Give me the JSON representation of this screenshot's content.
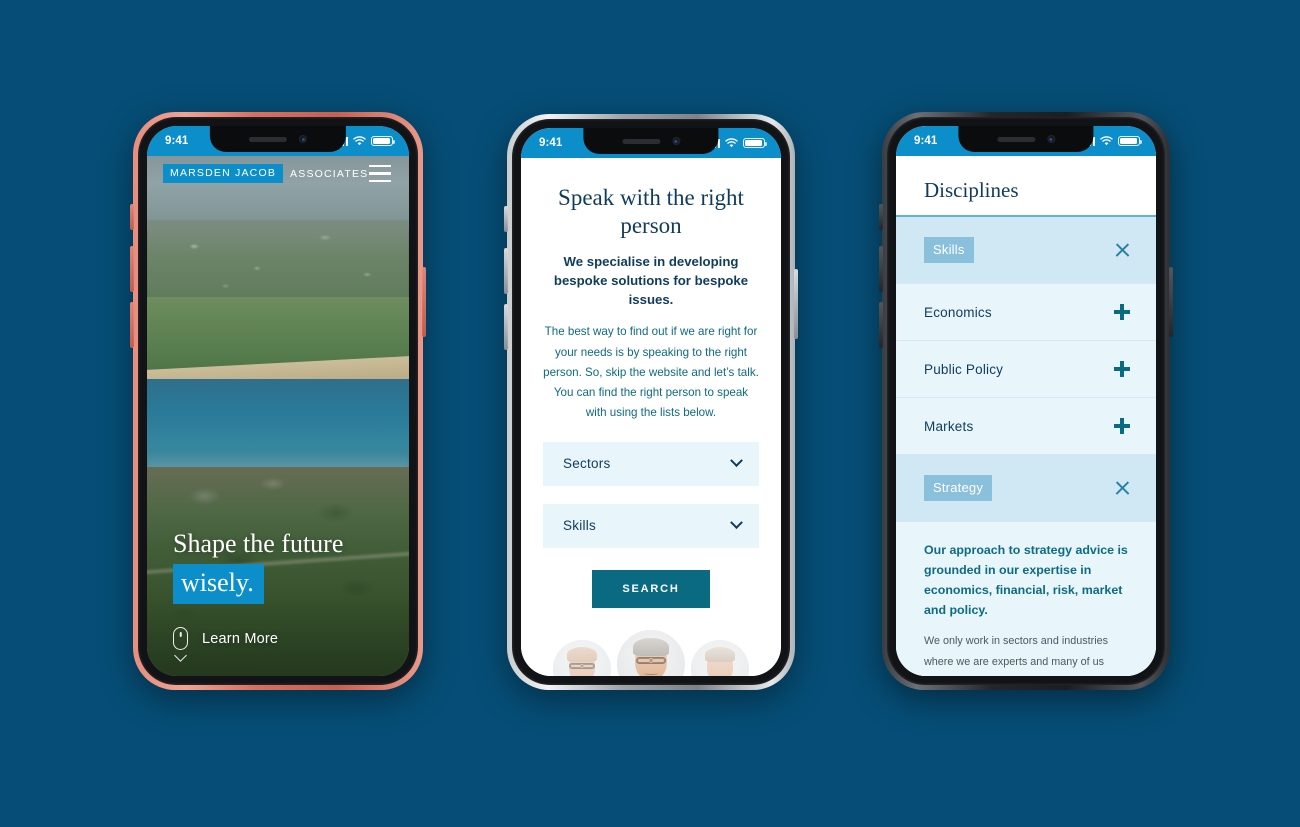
{
  "canvas": {
    "background_color": "#064e77"
  },
  "brand": {
    "accent_blue": "#0c8ecb",
    "deep_teal": "#0a6a82",
    "navy": "#0f3c5c",
    "pale_blue": "#e8f5fb",
    "chip_blue": "#8bc0dd"
  },
  "status_bar": {
    "time": "9:41",
    "signal": "signal-bars",
    "wifi": "wifi-icon",
    "battery": "battery-icon"
  },
  "phone1": {
    "frame_color": "coral",
    "nav": {
      "logo_mark": "MARSDEN JACOB",
      "logo_sub": "ASSOCIATES",
      "menu": "hamburger-menu"
    },
    "hero": {
      "headline_line1": "Shape the future",
      "headline_line2": "wisely.",
      "cta_label": "Learn More",
      "cta_icon": "scroll-mouse-icon"
    }
  },
  "phone2": {
    "frame_color": "silver",
    "title": "Speak with the right person",
    "lead": "We specialise in developing bespoke solutions for bespoke issues.",
    "paragraph": "The best way to find out if we are right for your needs is by speaking to the right person. So, skip the website and let’s talk. You can find the right person to speak with using the lists below.",
    "selects": [
      {
        "label": "Sectors",
        "icon": "chevron-down-icon"
      },
      {
        "label": "Skills",
        "icon": "chevron-down-icon"
      }
    ],
    "search_button": "SEARCH",
    "avatars": [
      {
        "name": "consultant-avatar-1",
        "size": "small"
      },
      {
        "name": "consultant-avatar-2",
        "size": "big"
      },
      {
        "name": "consultant-avatar-3",
        "size": "small"
      }
    ]
  },
  "phone3": {
    "frame_color": "space-grey",
    "title": "Disciplines",
    "items": [
      {
        "label": "Skills",
        "state": "expanded",
        "icon": "close-icon",
        "style": "chip"
      },
      {
        "label": "Economics",
        "state": "collapsed",
        "icon": "plus-icon",
        "style": "plain"
      },
      {
        "label": "Public Policy",
        "state": "collapsed",
        "icon": "plus-icon",
        "style": "plain"
      },
      {
        "label": "Markets",
        "state": "collapsed",
        "icon": "plus-icon",
        "style": "plain"
      },
      {
        "label": "Strategy",
        "state": "expanded",
        "icon": "close-icon",
        "style": "chip"
      }
    ],
    "panel": {
      "lead": "Our approach to strategy advice is grounded in our expertise in economics, financial, risk, market and policy.",
      "body": "We only work in sectors and industries where we are experts and many of us have commercial backgrounds in these"
    }
  }
}
